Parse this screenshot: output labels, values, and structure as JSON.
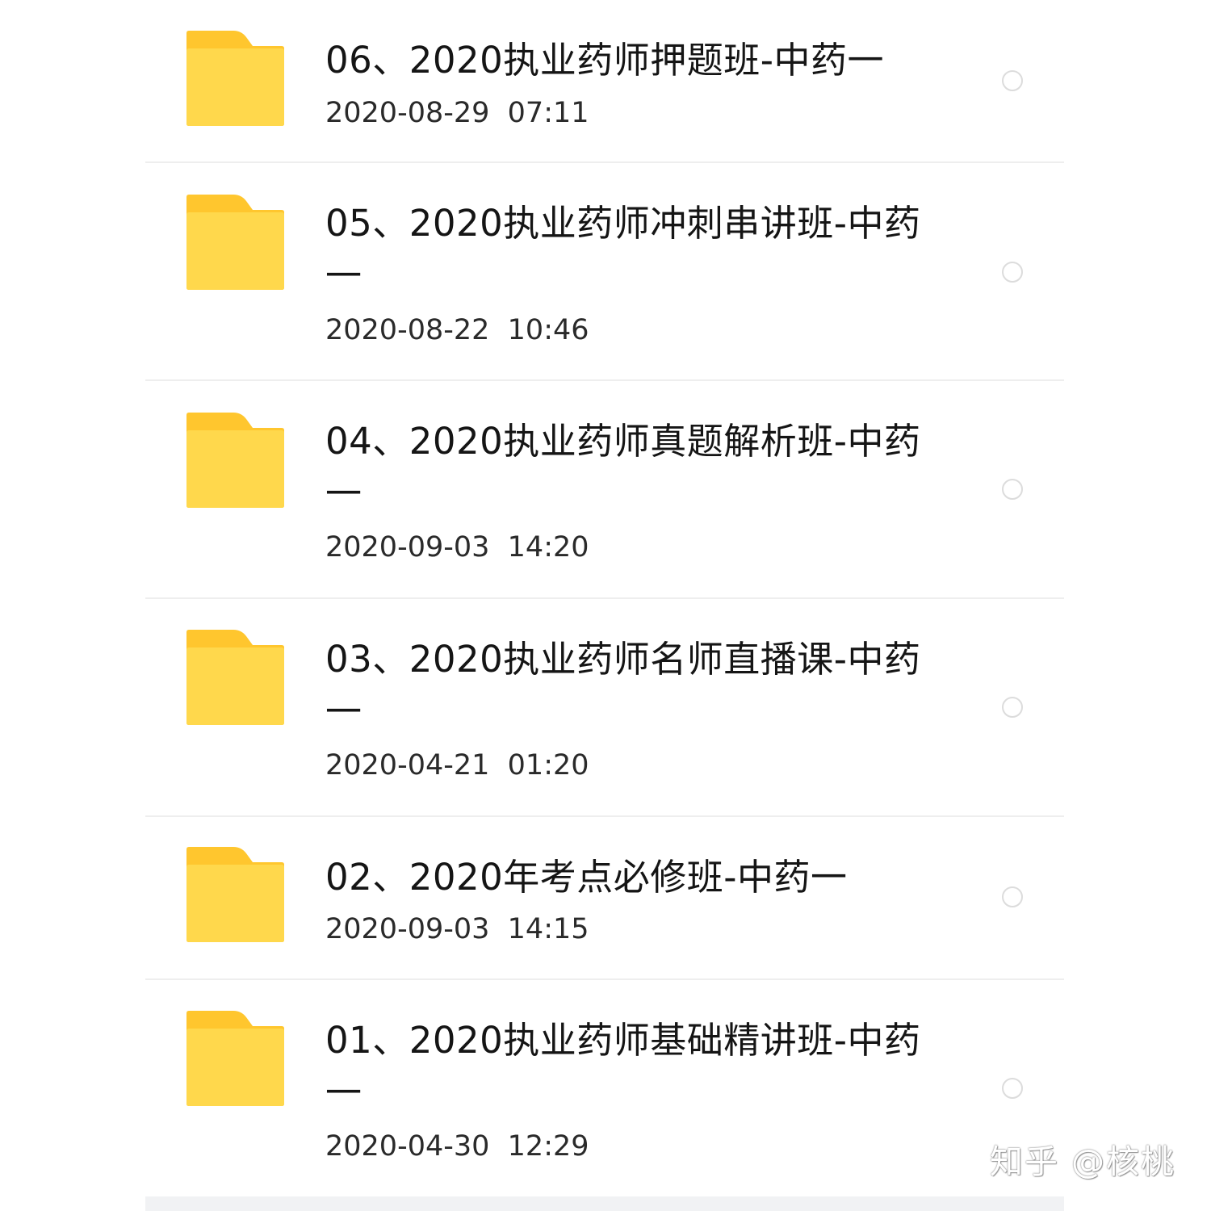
{
  "files": [
    {
      "name": "06、2020执业药师押题班-中药一",
      "date": "2020-08-29  07:11"
    },
    {
      "name": "05、2020执业药师冲刺串讲班-中药一",
      "date": "2020-08-22  10:46"
    },
    {
      "name": "04、2020执业药师真题解析班-中药一",
      "date": "2020-09-03  14:20"
    },
    {
      "name": "03、2020执业药师名师直播课-中药一",
      "date": "2020-04-21  01:20"
    },
    {
      "name": "02、2020年考点必修班-中药一",
      "date": "2020-09-03  14:15"
    },
    {
      "name": "01、2020执业药师基础精讲班-中药一",
      "date": "2020-04-30  12:29"
    }
  ],
  "watermark": "知乎 @核桃",
  "colors": {
    "folder_body": "#FFD84C",
    "folder_tab": "#FFC62E",
    "divider": "#EEEEEE",
    "radio_border": "#DCDCDC"
  },
  "icons": {
    "folder": "folder-icon",
    "select": "select-radio-icon"
  }
}
